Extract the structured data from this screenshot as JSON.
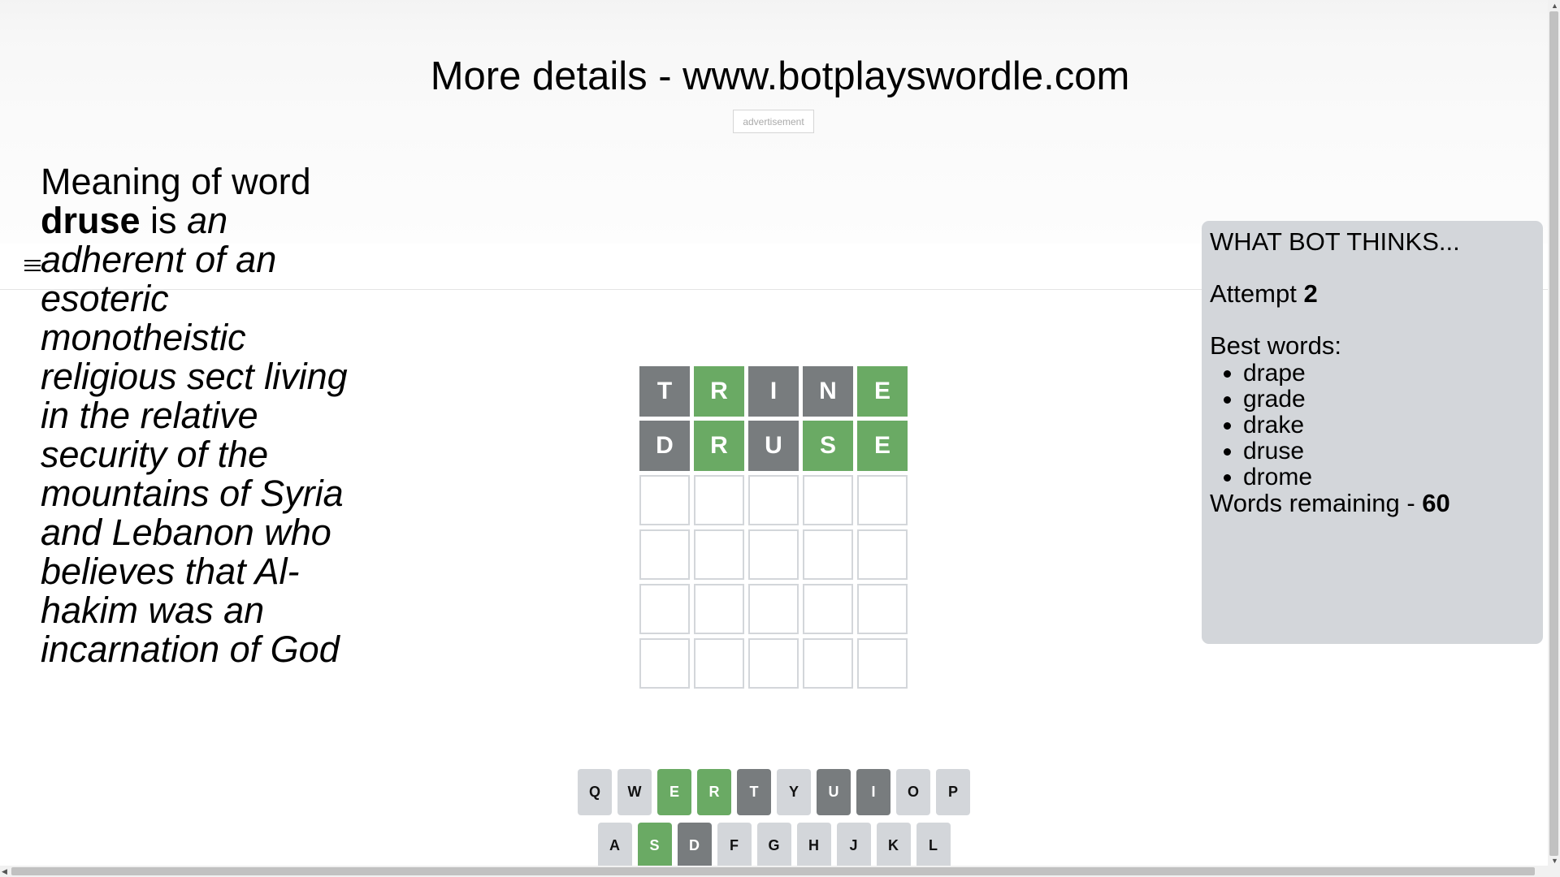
{
  "header": {
    "title": "More details - www.botplayswordle.com",
    "ad_label": "advertisement",
    "menu_icon": "hamburger-menu-icon"
  },
  "definition": {
    "prefix": "Meaning of word ",
    "word": "druse",
    "is": " is ",
    "meaning": "an adherent of an esoteric monotheistic religious sect living in the relative security of the mountains of Syria and Lebanon who believes that Al-hakim was an incarnation of God"
  },
  "board": {
    "rows": [
      [
        {
          "letter": "T",
          "state": "absent"
        },
        {
          "letter": "R",
          "state": "correct"
        },
        {
          "letter": "I",
          "state": "absent"
        },
        {
          "letter": "N",
          "state": "absent"
        },
        {
          "letter": "E",
          "state": "correct"
        }
      ],
      [
        {
          "letter": "D",
          "state": "absent"
        },
        {
          "letter": "R",
          "state": "correct"
        },
        {
          "letter": "U",
          "state": "absent"
        },
        {
          "letter": "S",
          "state": "correct"
        },
        {
          "letter": "E",
          "state": "correct"
        }
      ],
      [
        {
          "letter": "",
          "state": "empty"
        },
        {
          "letter": "",
          "state": "empty"
        },
        {
          "letter": "",
          "state": "empty"
        },
        {
          "letter": "",
          "state": "empty"
        },
        {
          "letter": "",
          "state": "empty"
        }
      ],
      [
        {
          "letter": "",
          "state": "empty"
        },
        {
          "letter": "",
          "state": "empty"
        },
        {
          "letter": "",
          "state": "empty"
        },
        {
          "letter": "",
          "state": "empty"
        },
        {
          "letter": "",
          "state": "empty"
        }
      ],
      [
        {
          "letter": "",
          "state": "empty"
        },
        {
          "letter": "",
          "state": "empty"
        },
        {
          "letter": "",
          "state": "empty"
        },
        {
          "letter": "",
          "state": "empty"
        },
        {
          "letter": "",
          "state": "empty"
        }
      ],
      [
        {
          "letter": "",
          "state": "empty"
        },
        {
          "letter": "",
          "state": "empty"
        },
        {
          "letter": "",
          "state": "empty"
        },
        {
          "letter": "",
          "state": "empty"
        },
        {
          "letter": "",
          "state": "empty"
        }
      ]
    ]
  },
  "bot_panel": {
    "title": "WHAT BOT THINKS...",
    "attempt_label": "Attempt ",
    "attempt_value": "2",
    "best_words_label": "Best words:",
    "best_words": [
      "drape",
      "grade",
      "drake",
      "druse",
      "drome"
    ],
    "remaining_label": "Words remaining - ",
    "remaining_value": "60"
  },
  "keyboard": {
    "rows": [
      [
        {
          "key": "Q",
          "state": "unused"
        },
        {
          "key": "W",
          "state": "unused"
        },
        {
          "key": "E",
          "state": "correct"
        },
        {
          "key": "R",
          "state": "correct"
        },
        {
          "key": "T",
          "state": "absent"
        },
        {
          "key": "Y",
          "state": "unused"
        },
        {
          "key": "U",
          "state": "absent"
        },
        {
          "key": "I",
          "state": "absent"
        },
        {
          "key": "O",
          "state": "unused"
        },
        {
          "key": "P",
          "state": "unused"
        }
      ],
      [
        {
          "key": "A",
          "state": "unused"
        },
        {
          "key": "S",
          "state": "correct"
        },
        {
          "key": "D",
          "state": "absent"
        },
        {
          "key": "F",
          "state": "unused"
        },
        {
          "key": "G",
          "state": "unused"
        },
        {
          "key": "H",
          "state": "unused"
        },
        {
          "key": "J",
          "state": "unused"
        },
        {
          "key": "K",
          "state": "unused"
        },
        {
          "key": "L",
          "state": "unused"
        }
      ]
    ]
  },
  "colors": {
    "correct": "#6aaa64",
    "absent": "#787c7e",
    "unused_key": "#d3d6da",
    "panel_bg": "#d3d6da"
  }
}
